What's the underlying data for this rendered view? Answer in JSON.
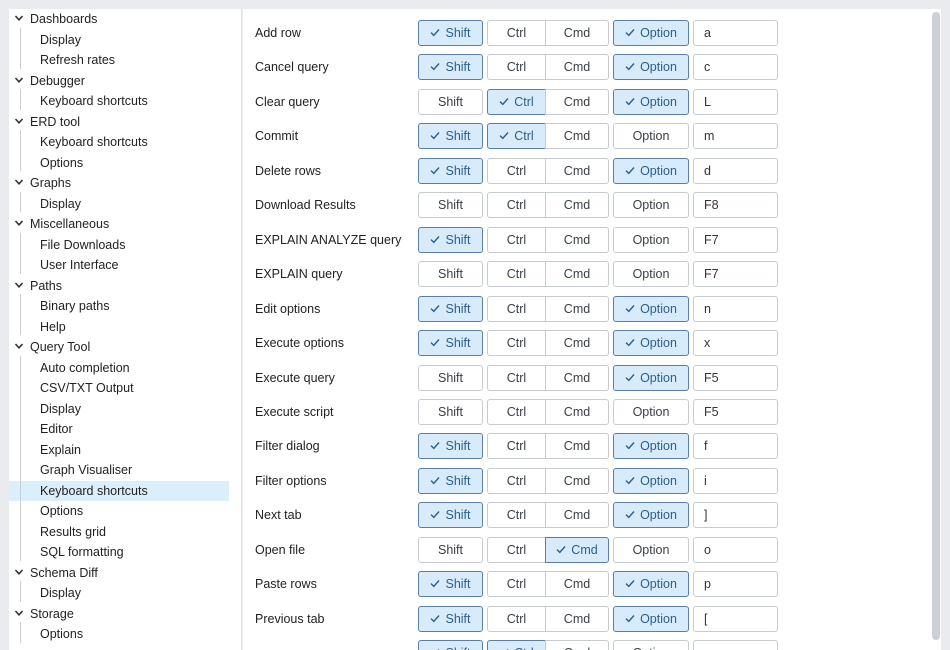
{
  "sidebar": {
    "groups": [
      {
        "label": "Dashboards",
        "children": [
          "Display",
          "Refresh rates"
        ]
      },
      {
        "label": "Debugger",
        "children": [
          "Keyboard shortcuts"
        ]
      },
      {
        "label": "ERD tool",
        "children": [
          "Keyboard shortcuts",
          "Options"
        ]
      },
      {
        "label": "Graphs",
        "children": [
          "Display"
        ]
      },
      {
        "label": "Miscellaneous",
        "children": [
          "File Downloads",
          "User Interface"
        ]
      },
      {
        "label": "Paths",
        "children": [
          "Binary paths",
          "Help"
        ]
      },
      {
        "label": "Query Tool",
        "children": [
          "Auto completion",
          "CSV/TXT Output",
          "Display",
          "Editor",
          "Explain",
          "Graph Visualiser",
          "Keyboard shortcuts",
          "Options",
          "Results grid",
          "SQL formatting"
        ]
      },
      {
        "label": "Schema Diff",
        "children": [
          "Display"
        ]
      },
      {
        "label": "Storage",
        "children": [
          "Options"
        ]
      }
    ],
    "selected": "Query Tool > Keyboard shortcuts"
  },
  "modifiers": {
    "shift": "Shift",
    "ctrl": "Ctrl",
    "cmd": "Cmd",
    "option": "Option"
  },
  "shortcuts": [
    {
      "label": "Add row",
      "shift": true,
      "ctrl": false,
      "cmd": false,
      "option": true,
      "key": "a"
    },
    {
      "label": "Cancel query",
      "shift": true,
      "ctrl": false,
      "cmd": false,
      "option": true,
      "key": "c"
    },
    {
      "label": "Clear query",
      "shift": false,
      "ctrl": true,
      "cmd": false,
      "option": true,
      "key": "L"
    },
    {
      "label": "Commit",
      "shift": true,
      "ctrl": true,
      "cmd": false,
      "option": false,
      "key": "m"
    },
    {
      "label": "Delete rows",
      "shift": true,
      "ctrl": false,
      "cmd": false,
      "option": true,
      "key": "d"
    },
    {
      "label": "Download Results",
      "shift": false,
      "ctrl": false,
      "cmd": false,
      "option": false,
      "key": "F8"
    },
    {
      "label": "EXPLAIN ANALYZE query",
      "shift": true,
      "ctrl": false,
      "cmd": false,
      "option": false,
      "key": "F7"
    },
    {
      "label": "EXPLAIN query",
      "shift": false,
      "ctrl": false,
      "cmd": false,
      "option": false,
      "key": "F7"
    },
    {
      "label": "Edit options",
      "shift": true,
      "ctrl": false,
      "cmd": false,
      "option": true,
      "key": "n"
    },
    {
      "label": "Execute options",
      "shift": true,
      "ctrl": false,
      "cmd": false,
      "option": true,
      "key": "x"
    },
    {
      "label": "Execute query",
      "shift": false,
      "ctrl": false,
      "cmd": false,
      "option": true,
      "key": "F5"
    },
    {
      "label": "Execute script",
      "shift": false,
      "ctrl": false,
      "cmd": false,
      "option": false,
      "key": "F5"
    },
    {
      "label": "Filter dialog",
      "shift": true,
      "ctrl": false,
      "cmd": false,
      "option": true,
      "key": "f"
    },
    {
      "label": "Filter options",
      "shift": true,
      "ctrl": false,
      "cmd": false,
      "option": true,
      "key": "i"
    },
    {
      "label": "Next tab",
      "shift": true,
      "ctrl": false,
      "cmd": false,
      "option": true,
      "key": "]"
    },
    {
      "label": "Open file",
      "shift": false,
      "ctrl": false,
      "cmd": true,
      "option": false,
      "key": "o"
    },
    {
      "label": "Paste rows",
      "shift": true,
      "ctrl": false,
      "cmd": false,
      "option": true,
      "key": "p"
    },
    {
      "label": "Previous tab",
      "shift": true,
      "ctrl": false,
      "cmd": false,
      "option": true,
      "key": "["
    },
    {
      "label": "",
      "shift": true,
      "ctrl": true,
      "cmd": false,
      "option": false,
      "key": ""
    }
  ],
  "colors": {
    "accent_bg": "#d7ebfa",
    "accent_border": "#5a7fa3",
    "selected_row": "#dbeefb"
  }
}
